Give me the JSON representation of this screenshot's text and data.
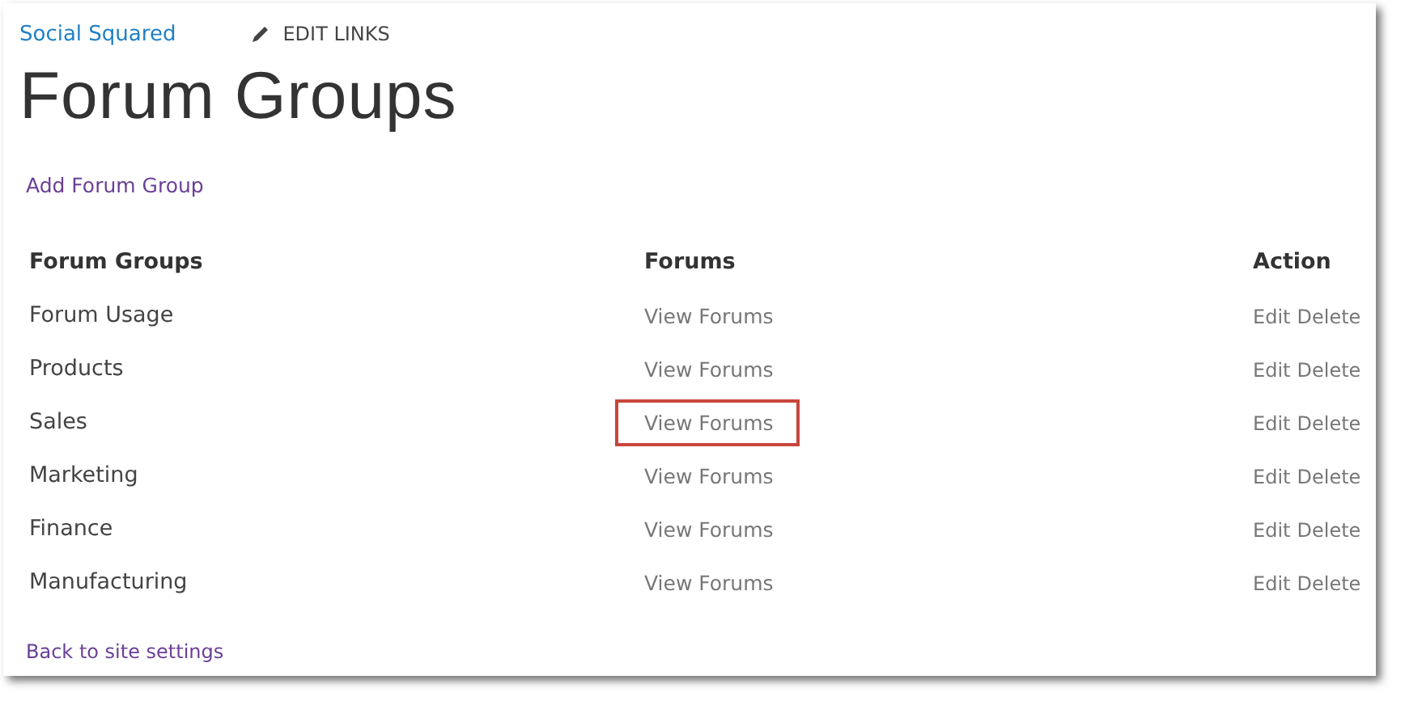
{
  "top_bar": {
    "site_link": "Social Squared",
    "edit_links": "EDIT LINKS"
  },
  "page_title": "Forum Groups",
  "add_link": "Add Forum Group",
  "table": {
    "columns": [
      "Forum Groups",
      "Forums",
      "Action"
    ],
    "rows": [
      {
        "name": "Forum Usage",
        "forums_link": "View Forums",
        "edit": "Edit",
        "delete": "Delete",
        "highlighted": false
      },
      {
        "name": "Products",
        "forums_link": "View Forums",
        "edit": "Edit",
        "delete": "Delete",
        "highlighted": false
      },
      {
        "name": "Sales",
        "forums_link": "View Forums",
        "edit": "Edit",
        "delete": "Delete",
        "highlighted": true
      },
      {
        "name": "Marketing",
        "forums_link": "View Forums",
        "edit": "Edit",
        "delete": "Delete",
        "highlighted": false
      },
      {
        "name": "Finance",
        "forums_link": "View Forums",
        "edit": "Edit",
        "delete": "Delete",
        "highlighted": false
      },
      {
        "name": "Manufacturing",
        "forums_link": "View Forums",
        "edit": "Edit",
        "delete": "Delete",
        "highlighted": false
      }
    ]
  },
  "back_link": "Back to site settings"
}
